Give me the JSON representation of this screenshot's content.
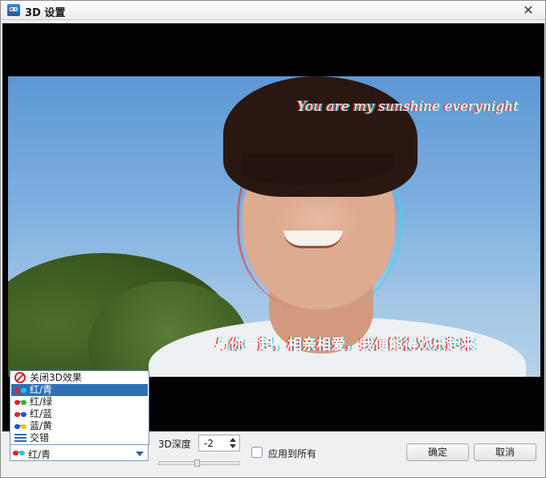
{
  "window": {
    "title": "3D 设置",
    "close_glyph": "✕"
  },
  "video": {
    "subtitle_top": "You are my sunshine everynight",
    "subtitle_bottom": "与你一起，相亲相爱，我便能得欢乐起来"
  },
  "mode_dropdown": {
    "options": [
      {
        "label": "关闭3D效果",
        "icon": "no-3d-icon"
      },
      {
        "label": "红/青",
        "icon": "red-cyan-glasses-icon",
        "left_color": "#e02424",
        "right_color": "#1fc6e8"
      },
      {
        "label": "红/绿",
        "icon": "red-green-glasses-icon",
        "left_color": "#e02424",
        "right_color": "#2fb23a"
      },
      {
        "label": "红/蓝",
        "icon": "red-blue-glasses-icon",
        "left_color": "#e02424",
        "right_color": "#2050d8"
      },
      {
        "label": "蓝/黄",
        "icon": "blue-yellow-glasses-icon",
        "left_color": "#2050d8",
        "right_color": "#f2c20f"
      },
      {
        "label": "交错",
        "icon": "interlaced-lines-icon"
      }
    ],
    "selected_index": 1,
    "selected_label": "红/青"
  },
  "depth": {
    "label": "3D深度",
    "value": "-2",
    "slider_fraction": 0.47
  },
  "apply_all": {
    "label": "应用到所有",
    "checked": false
  },
  "buttons": {
    "ok": "确定",
    "cancel": "取消"
  },
  "colors": {
    "selection": "#2f6fb6",
    "dropdown_border": "#6f8fbb"
  }
}
